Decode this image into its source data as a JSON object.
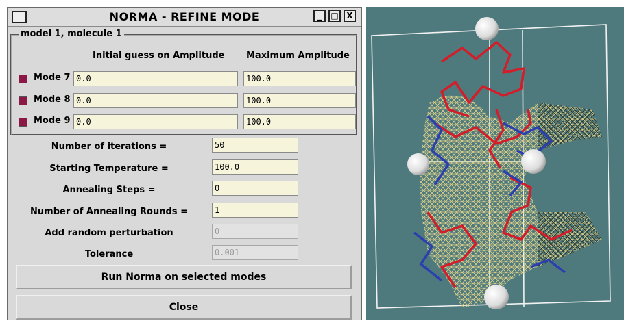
{
  "window": {
    "title": "NORMA - REFINE MODE",
    "minimize_glyph": "_",
    "maximize_glyph": "□",
    "close_glyph": "X"
  },
  "group": {
    "legend": "model 1,  molecule 1",
    "col_initial": "Initial guess on Amplitude",
    "col_max": "Maximum Amplitude",
    "modes": [
      {
        "label": "Mode 7",
        "checked": true,
        "initial": "0.0",
        "max": "100.0"
      },
      {
        "label": "Mode 8",
        "checked": true,
        "initial": "0.0",
        "max": "100.0"
      },
      {
        "label": "Mode 9",
        "checked": true,
        "initial": "0.0",
        "max": "100.0"
      }
    ]
  },
  "params": [
    {
      "label": "Number of iterations =",
      "value": "50",
      "enabled": true
    },
    {
      "label": "Starting Temperature =",
      "value": "100.0",
      "enabled": true
    },
    {
      "label": "Annealing Steps =",
      "value": "0",
      "enabled": true
    },
    {
      "label": "Number of Annealing Rounds =",
      "value": "1",
      "enabled": true
    },
    {
      "label": "Add random perturbation",
      "value": "0",
      "enabled": false
    },
    {
      "label": "Tolerance",
      "value": "0.001",
      "enabled": false
    }
  ],
  "buttons": {
    "run": "Run Norma on selected modes",
    "close": "Close"
  },
  "colors": {
    "viewer_bg": "#4f7a7d",
    "checkbox": "#8a1a45",
    "field_bg": "#f6f5dc",
    "trace_red": "#d21e2a",
    "trace_blue": "#2b3fae",
    "mesh_yellow": "#e8d68a"
  }
}
